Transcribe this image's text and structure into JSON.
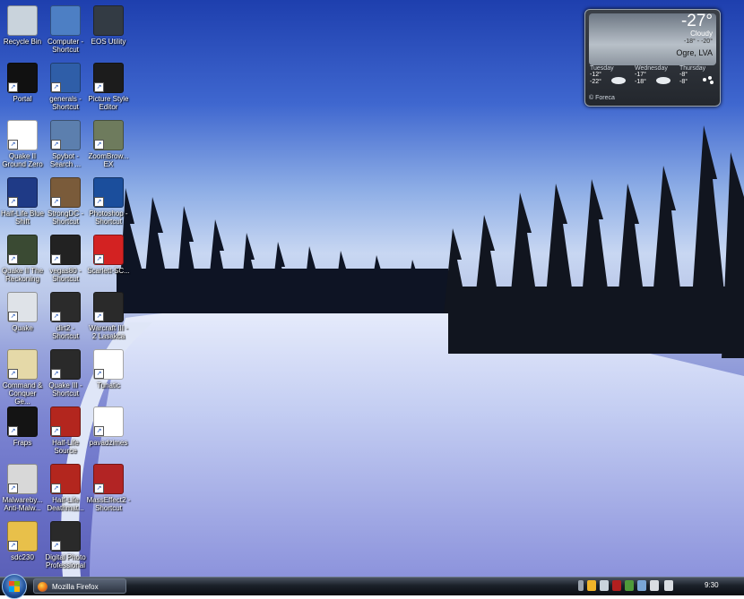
{
  "desktop": {
    "icons": [
      {
        "label": "Recycle Bin",
        "icon": "recycle-bin-icon",
        "color": "#c9d3dc"
      },
      {
        "label": "Computer - Shortcut",
        "icon": "computer-icon",
        "color": "#4d7fc4"
      },
      {
        "label": "EOS Utility",
        "icon": "eos-utility-icon",
        "color": "#333b44"
      },
      {
        "label": "Portal",
        "icon": "portal-icon",
        "color": "#111111"
      },
      {
        "label": "generals - Shortcut",
        "icon": "generals-icon",
        "color": "#2f5ea8"
      },
      {
        "label": "Picture Style Editor",
        "icon": "picture-style-editor-icon",
        "color": "#1c1c1c"
      },
      {
        "label": "Quake II Ground Zero",
        "icon": "document-icon",
        "color": "#ffffff"
      },
      {
        "label": "Spybot - Search ...",
        "icon": "spybot-icon",
        "color": "#5c7fae"
      },
      {
        "label": "ZoomBrow... EX",
        "icon": "zoombrowser-icon",
        "color": "#6e7b5d"
      },
      {
        "label": "Half-Life Blue Shift",
        "icon": "half-life-icon",
        "color": "#1f3a86"
      },
      {
        "label": "StrongDC - Shortcut",
        "icon": "strongdc-icon",
        "color": "#7a5b3a"
      },
      {
        "label": "Photoshop - Shortcut",
        "icon": "photoshop-icon",
        "color": "#1b4e9c"
      },
      {
        "label": "Quake II The Reckoning",
        "icon": "quake-icon",
        "color": "#3a4a33"
      },
      {
        "label": "vegas80 - Shortcut",
        "icon": "vegas-icon",
        "color": "#222222"
      },
      {
        "label": "Scarlett-SC...",
        "icon": "pdf-icon",
        "color": "#d32222"
      },
      {
        "label": "Quake",
        "icon": "quake-icon",
        "color": "#dfe3e8"
      },
      {
        "label": "dirt2 - Shortcut",
        "icon": "dirt2-icon",
        "color": "#2b2b2b"
      },
      {
        "label": "Warcraft III - 2 Lasakca",
        "icon": "warcraft-icon",
        "color": "#2a2a2a"
      },
      {
        "label": "Command & Conquer Ge...",
        "icon": "command-conquer-icon",
        "color": "#e5d9a8"
      },
      {
        "label": "Quake III - Shortcut",
        "icon": "quake-iii-icon",
        "color": "#2a2a2a"
      },
      {
        "label": "Tunatic",
        "icon": "music-note-icon",
        "color": "#ffffff"
      },
      {
        "label": "Fraps",
        "icon": "fraps-icon",
        "color": "#141414"
      },
      {
        "label": "Half-Life Source",
        "icon": "half-life-icon",
        "color": "#b3261e"
      },
      {
        "label": "pavadzimes",
        "icon": "excel-icon",
        "color": "#ffffff"
      },
      {
        "label": "Malwareby... Anti-Malw...",
        "icon": "malwarebytes-icon",
        "color": "#d8d8d8"
      },
      {
        "label": "Half-Life Deathmat...",
        "icon": "half-life-icon",
        "color": "#b3261e"
      },
      {
        "label": "MassEffect2 - Shortcut",
        "icon": "masseffect-icon",
        "color": "#b22424"
      },
      {
        "label": "sdc230",
        "icon": "folder-icon",
        "color": "#e8c04a"
      },
      {
        "label": "Digital Photo Professional",
        "icon": "digital-photo-icon",
        "color": "#2a2a2a"
      }
    ]
  },
  "weather": {
    "temperature": "-27°",
    "condition": "Cloudy",
    "hilo": "-18° - -20°",
    "city": "Ogre, LVA",
    "forecast": [
      {
        "day": "Tuesday",
        "high": "-12°",
        "low": "-22°",
        "icon": "cloud-icon"
      },
      {
        "day": "Wednesday",
        "high": "-17°",
        "low": "-18°",
        "icon": "cloud-icon"
      },
      {
        "day": "Thursday",
        "high": "-8°",
        "low": "-8°",
        "icon": "snow-icon"
      }
    ],
    "source": "© Foreca"
  },
  "taskbar": {
    "task_label": "Mozilla Firefox",
    "clock": "9:30"
  }
}
